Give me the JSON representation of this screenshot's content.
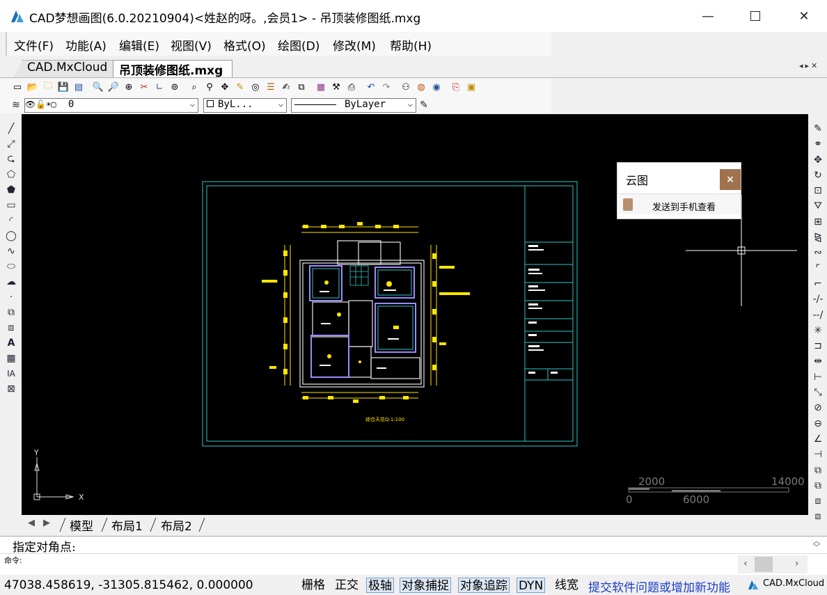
{
  "window": {
    "title": "CAD梦想画图(6.0.20210904)<姓赵的呀。,会员1> - 吊顶装修图纸.mxg",
    "minimize_icon": "minimize-icon",
    "maximize_icon": "maximize-icon",
    "close_icon": "close-icon"
  },
  "menu": [
    {
      "label": "文件(F)"
    },
    {
      "label": "功能(A)"
    },
    {
      "label": "编辑(E)"
    },
    {
      "label": "视图(V)"
    },
    {
      "label": "格式(O)"
    },
    {
      "label": "绘图(D)"
    },
    {
      "label": "修改(M)"
    },
    {
      "label": "帮助(H)"
    }
  ],
  "tabs": {
    "cloud": "CAD.MxCloud",
    "active": "吊顶装修图纸.mxg"
  },
  "properties": {
    "layer": "0",
    "color": "ByL...",
    "linetype": "ByLayer"
  },
  "cloud_panel": {
    "title": "云图",
    "close": "×",
    "send_label": "发送到手机查看"
  },
  "drawing": {
    "caption": "综合天花Q:1:100",
    "axis_y": "Y",
    "axis_x": "X",
    "scale_labels": {
      "a": "2000",
      "b": "14000",
      "c": "0",
      "d": "6000"
    }
  },
  "layout_tabs": [
    {
      "label": "模型"
    },
    {
      "label": "布局1"
    },
    {
      "label": "布局2"
    }
  ],
  "command": {
    "prompt": "指定对角点:",
    "history": "命令:"
  },
  "status": {
    "coords": "47038.458619,  -31305.815462,  0.000000",
    "toggles": [
      {
        "label": "栅格",
        "on": false
      },
      {
        "label": "正交",
        "on": false
      },
      {
        "label": "极轴",
        "on": true
      },
      {
        "label": "对象捕捉",
        "on": true
      },
      {
        "label": "对象追踪",
        "on": true
      },
      {
        "label": "DYN",
        "on": true
      },
      {
        "label": "线宽",
        "on": false
      }
    ],
    "feedback": "提交软件问题或增加新功能",
    "brand": "CAD.MxCloud"
  },
  "colors": {
    "canvas_bg": "#000000",
    "cad_cyan": "#31c7c7",
    "cad_yellow": "#ffe600",
    "accent_blue": "#1a3cc8",
    "cloud_close_bg": "#a0724e"
  }
}
